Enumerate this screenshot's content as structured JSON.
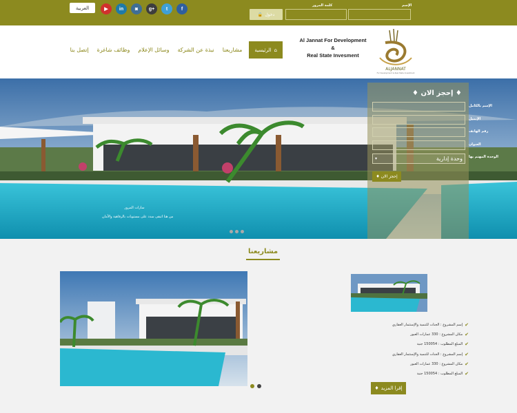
{
  "topbar": {
    "language_label": "العربية",
    "socials": [
      {
        "name": "youtube-icon",
        "glyph": "▶",
        "color": "#d0312d"
      },
      {
        "name": "linkedin-icon",
        "glyph": "in",
        "color": "#1f7aa8"
      },
      {
        "name": "instagram-icon",
        "glyph": "◙",
        "color": "#3f6e96"
      },
      {
        "name": "googleplus-icon",
        "glyph": "g+",
        "color": "#3d3d3d"
      },
      {
        "name": "twitter-icon",
        "glyph": "t",
        "color": "#3fa0d6"
      },
      {
        "name": "facebook-icon",
        "glyph": "f",
        "color": "#2f5f9e"
      }
    ],
    "name_label": "الإسم",
    "password_label": "كلمة المرور",
    "login_label": "دخول"
  },
  "header": {
    "logo_text_line1": "Al Jannat For Development",
    "logo_text_line2": "&",
    "logo_text_line3": "Real State Invesment",
    "logo_word": "ALJANNAT",
    "logo_sub": "For Development & Real State Investment",
    "nav": [
      "الرئيسية",
      "مشاريعنا",
      "نبذة عن الشركة",
      "وسائل الإعلام",
      "وظائف شاغرة",
      "إتصل بنا"
    ]
  },
  "hero": {
    "caption_title": "سارات المرور",
    "caption_sub": "من هنا اتبقى سدد على مستويات بالرفاهية والأمان"
  },
  "booking": {
    "title": "إحجز الان",
    "fields": [
      "الإسم بالكامل",
      "الإيميل",
      "رقم الهاتف",
      "العنوان",
      "الوحدة المهتم بها"
    ],
    "unit_value": "وحدة إدارية",
    "submit_label": "إحجز الان"
  },
  "projects": {
    "title": "مشاريعنا",
    "info": [
      "إسم المشروع : الجنات للتنمية والإستثمار العقاري",
      "مكان المشروع : 330 عمارات العبور",
      "المبلغ المطلوب : 150054 جنية",
      "إسم المشروع : الجنات للتنمية والإستثمار العقاري",
      "مكان المشروع : 330 عمارات العبور",
      "المبلغ المطلوب : 150054 جنية"
    ],
    "more_label": "إقرا المزيد"
  },
  "colors": {
    "accent": "#8c8a1f",
    "accent_light": "#dcdba4"
  }
}
